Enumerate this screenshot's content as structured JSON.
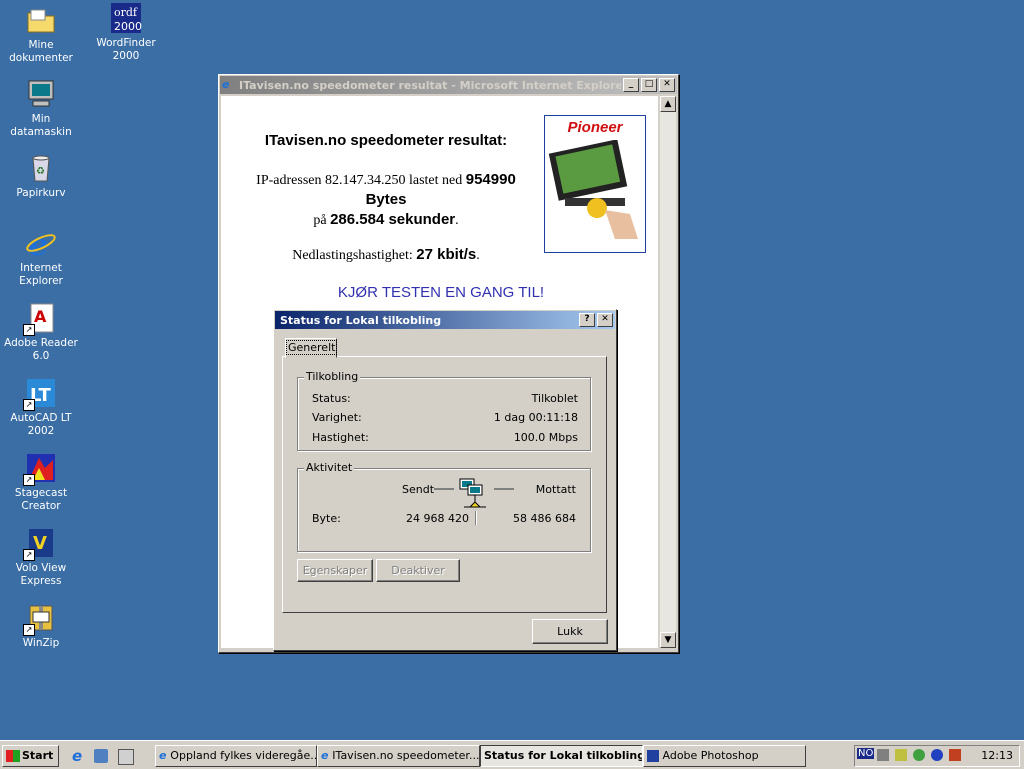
{
  "desktop": {
    "icons": [
      {
        "label": "Mine dokumenter",
        "icon": "folder-icon"
      },
      {
        "label": "WordFinder 2000",
        "icon": "wordfinder-icon"
      },
      {
        "label": "Min datamaskin",
        "icon": "computer-icon"
      },
      {
        "label": "Papirkurv",
        "icon": "recycle-bin-icon"
      },
      {
        "label": "Internet Explorer",
        "icon": "ie-icon"
      },
      {
        "label": "Adobe Reader 6.0",
        "icon": "adobe-reader-icon"
      },
      {
        "label": "AutoCAD LT 2002",
        "icon": "autocad-icon"
      },
      {
        "label": "Stagecast Creator",
        "icon": "stagecast-icon"
      },
      {
        "label": "Volo View Express",
        "icon": "volo-view-icon"
      },
      {
        "label": "WinZip",
        "icon": "winzip-icon"
      }
    ]
  },
  "ie_window": {
    "title": "ITavisen.no speedometer resultat - Microsoft Internet Explorer p...",
    "heading": "ITavisen.no speedometer resultat:",
    "ip_prefix": "IP-adressen 82.147.34.250 lastet ned ",
    "bytes_value": "954990",
    "bytes_label": "Bytes",
    "on_label": "på ",
    "seconds_value": "286.584 sekunder",
    "period": ".",
    "speed_label": "Nedlastingshastighet: ",
    "speed_value": "27 kbit/s",
    "speed_period": ".",
    "rerun_link": "KJØR TESTEN EN GANG TIL!",
    "ad_brand": "Pioneer"
  },
  "status_dialog": {
    "title": "Status for Lokal tilkobling",
    "help_button": "?",
    "close_button": "✕",
    "tab": "Generelt",
    "connection": {
      "group_title": "Tilkobling",
      "rows": [
        {
          "label": "Status:",
          "value": "Tilkoblet"
        },
        {
          "label": "Varighet:",
          "value": "1 dag 00:11:18"
        },
        {
          "label": "Hastighet:",
          "value": "100.0 Mbps"
        }
      ]
    },
    "activity": {
      "group_title": "Aktivitet",
      "sent_label": "Sendt",
      "received_label": "Mottatt",
      "bytes_label": "Byte:",
      "sent_value": "24 968 420",
      "received_value": "58 486 684"
    },
    "properties_button": "Egenskaper",
    "disable_button": "Deaktiver",
    "close_dialog_button": "Lukk"
  },
  "taskbar": {
    "start": "Start",
    "tasks": [
      {
        "label": "Oppland fylkes videregåe...",
        "active": false
      },
      {
        "label": "ITavisen.no speedometer...",
        "active": false
      },
      {
        "label": "Status for Lokal tilkobling",
        "active": true
      },
      {
        "label": "Adobe Photoshop",
        "active": false
      }
    ],
    "tray_lang": "NO",
    "clock": "12:13"
  }
}
